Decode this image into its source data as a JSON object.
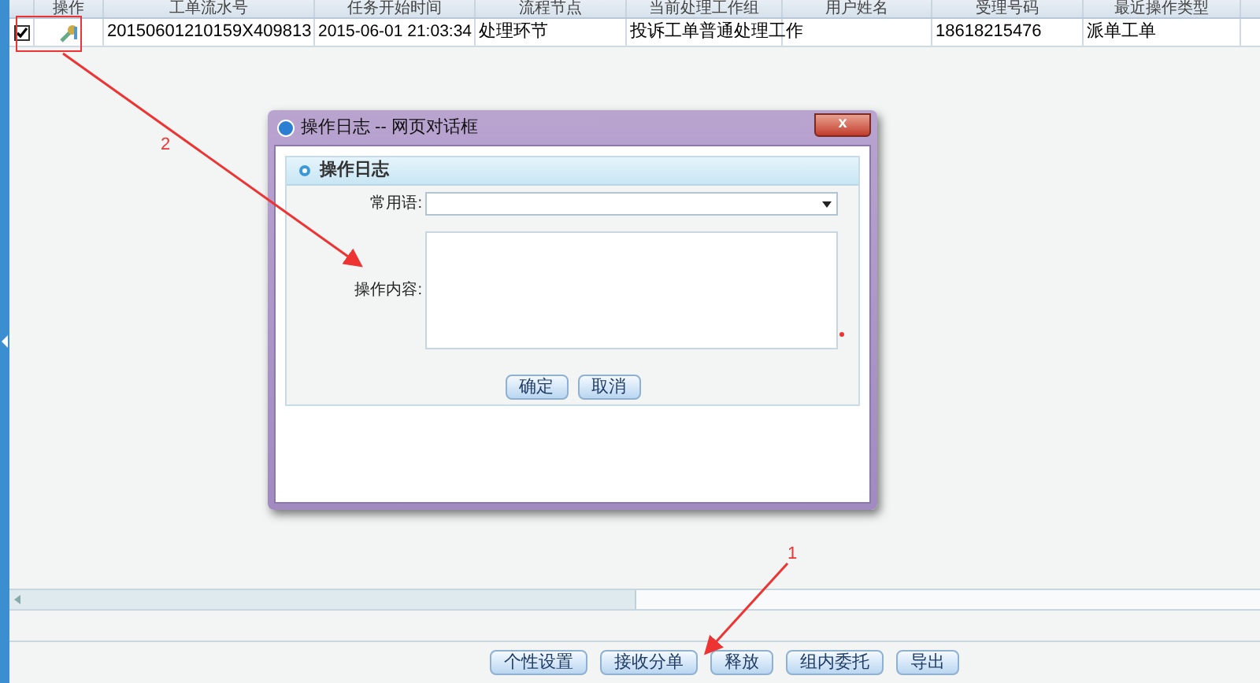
{
  "table": {
    "columns": [
      "操作",
      "工单流水号",
      "任务开始时间",
      "流程节点",
      "当前处理工作组",
      "用户姓名",
      "受理号码",
      "最近操作类型"
    ],
    "rows": [
      {
        "checked": true,
        "cells": [
          "",
          "20150601210159X409813",
          "2015-06-01 21:03:34",
          "处理环节",
          "投诉工单普通处理工作",
          "",
          "18618215476",
          "派单工单"
        ]
      }
    ]
  },
  "toolbar": {
    "buttons": [
      "个性设置",
      "接收分单",
      "释放",
      "组内委托",
      "导出"
    ]
  },
  "dialog": {
    "title": "操作日志 -- 网页对话框",
    "close": "x",
    "section_title": "操作日志",
    "fields": [
      {
        "kind": "select",
        "label": "常用语:"
      },
      {
        "kind": "textarea",
        "label": "操作内容:",
        "required": true
      }
    ],
    "buttons": [
      "确定",
      "取消"
    ]
  },
  "annotations": [
    {
      "label": "1"
    },
    {
      "label": "2"
    }
  ]
}
